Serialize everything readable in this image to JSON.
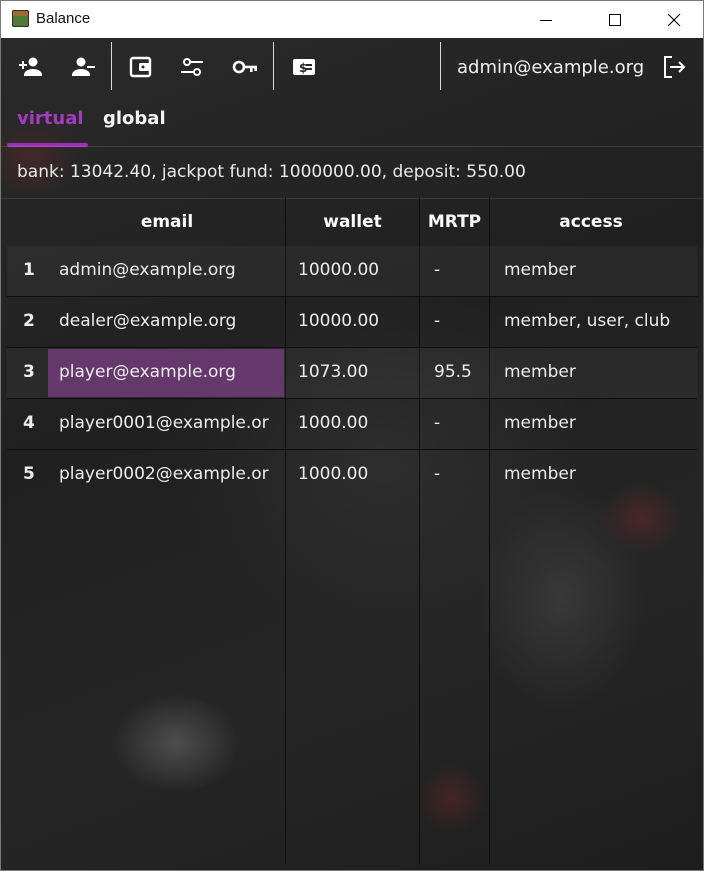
{
  "window": {
    "title": "Balance"
  },
  "toolbar": {
    "buttons": [
      {
        "name": "add-user-icon"
      },
      {
        "name": "remove-user-icon"
      },
      {
        "name": "wallet-icon"
      },
      {
        "name": "settings-sliders-icon"
      },
      {
        "name": "key-icon"
      },
      {
        "name": "money-icon"
      }
    ],
    "user_email": "admin@example.org",
    "logout_icon": "logout-icon"
  },
  "tabs": [
    {
      "label": "virtual",
      "active": true
    },
    {
      "label": "global",
      "active": false
    }
  ],
  "summary": "bank: 13042.40, jackpot fund: 1000000.00, deposit: 550.00",
  "table": {
    "columns": [
      "email",
      "wallet",
      "MRTP",
      "access"
    ],
    "rows": [
      {
        "num": "1",
        "email": "admin@example.org",
        "wallet": "10000.00",
        "mrtp": "-",
        "access": "member"
      },
      {
        "num": "2",
        "email": "dealer@example.org",
        "wallet": "10000.00",
        "mrtp": "-",
        "access": "member, user, club"
      },
      {
        "num": "3",
        "email": "player@example.org",
        "wallet": "1073.00",
        "mrtp": "95.5",
        "access": "member"
      },
      {
        "num": "4",
        "email": "player0001@example.or",
        "wallet": "1000.00",
        "mrtp": "-",
        "access": "member"
      },
      {
        "num": "5",
        "email": "player0002@example.or",
        "wallet": "1000.00",
        "mrtp": "-",
        "access": "member"
      }
    ]
  },
  "colors": {
    "accent": "#9b30b8",
    "selection": "#8a4a94"
  }
}
